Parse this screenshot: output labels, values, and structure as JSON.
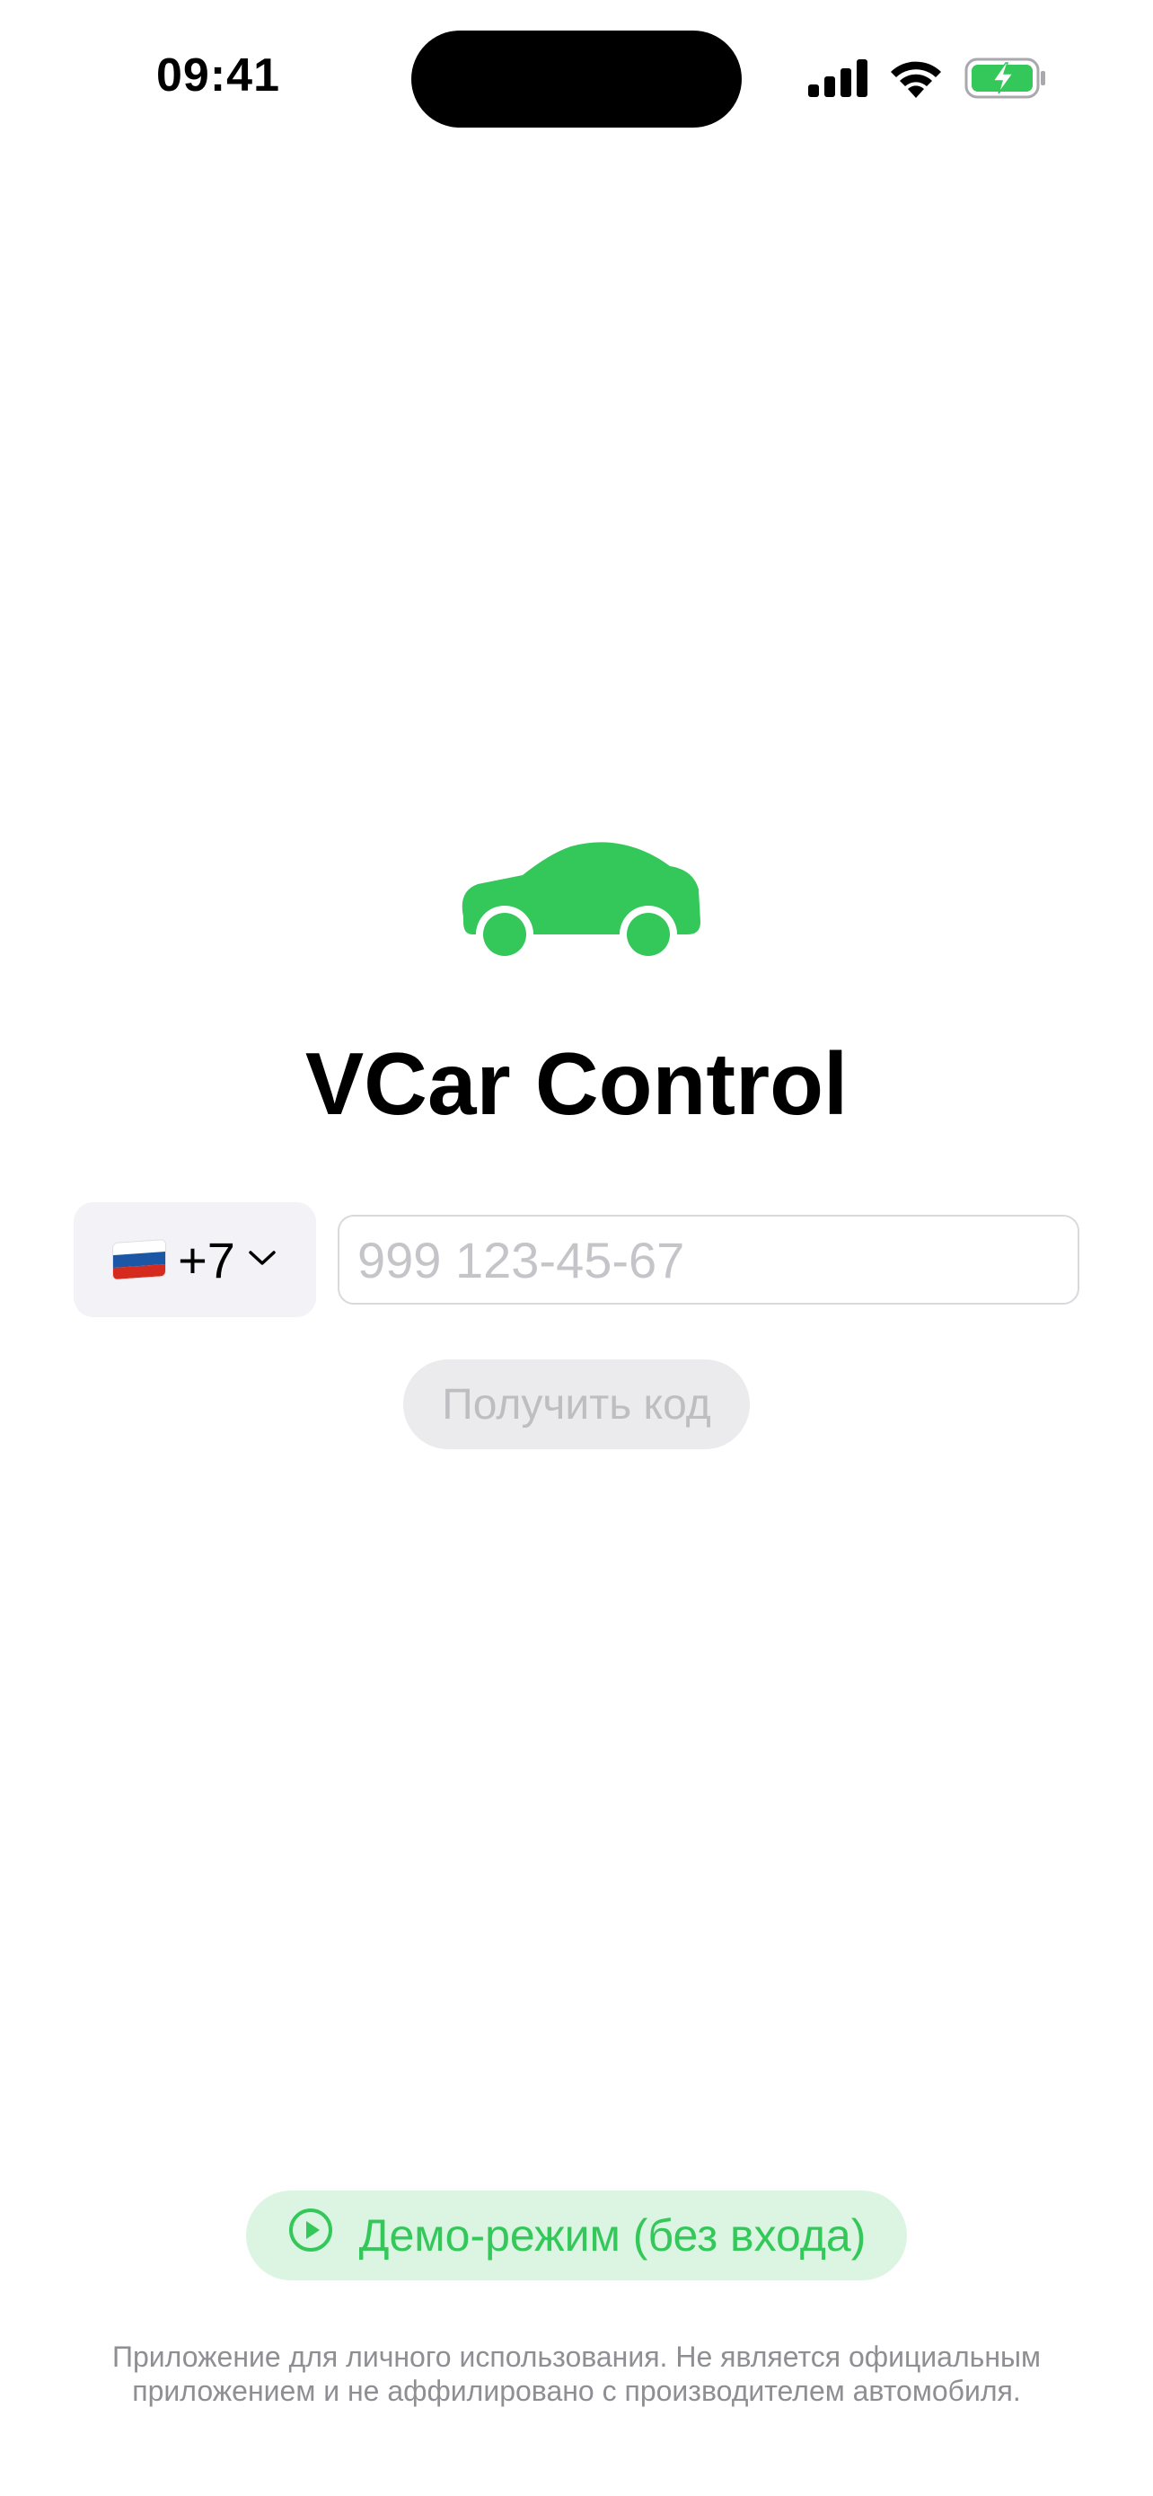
{
  "status_bar": {
    "time": "09:41",
    "icons": [
      "cellular-signal-icon",
      "wifi-icon",
      "battery-charging-icon"
    ]
  },
  "colors": {
    "accent": "#34C759",
    "accent_bg": "#DCF5E3",
    "disabled_bg": "#EBEBED",
    "disabled_text": "#BDBDC2",
    "picker_bg": "#F2F2F7",
    "muted_text": "#8E8E93"
  },
  "logo": {
    "icon": "car-icon"
  },
  "app_title": "VCar Control",
  "phone": {
    "country_flag": "russia-flag-icon",
    "dial_code": "+7",
    "chevron": "chevron-down-icon",
    "value": "",
    "placeholder": "999 123-45-67"
  },
  "get_code_button": {
    "label": "Получить код",
    "enabled": false
  },
  "demo_button": {
    "label": "Демо-режим (без входа)",
    "icon": "play-circle-icon"
  },
  "disclaimer": {
    "line1": "Приложение для личного использования. Не является официальным",
    "line2": "приложением и не аффилировано с производителем автомобиля."
  }
}
